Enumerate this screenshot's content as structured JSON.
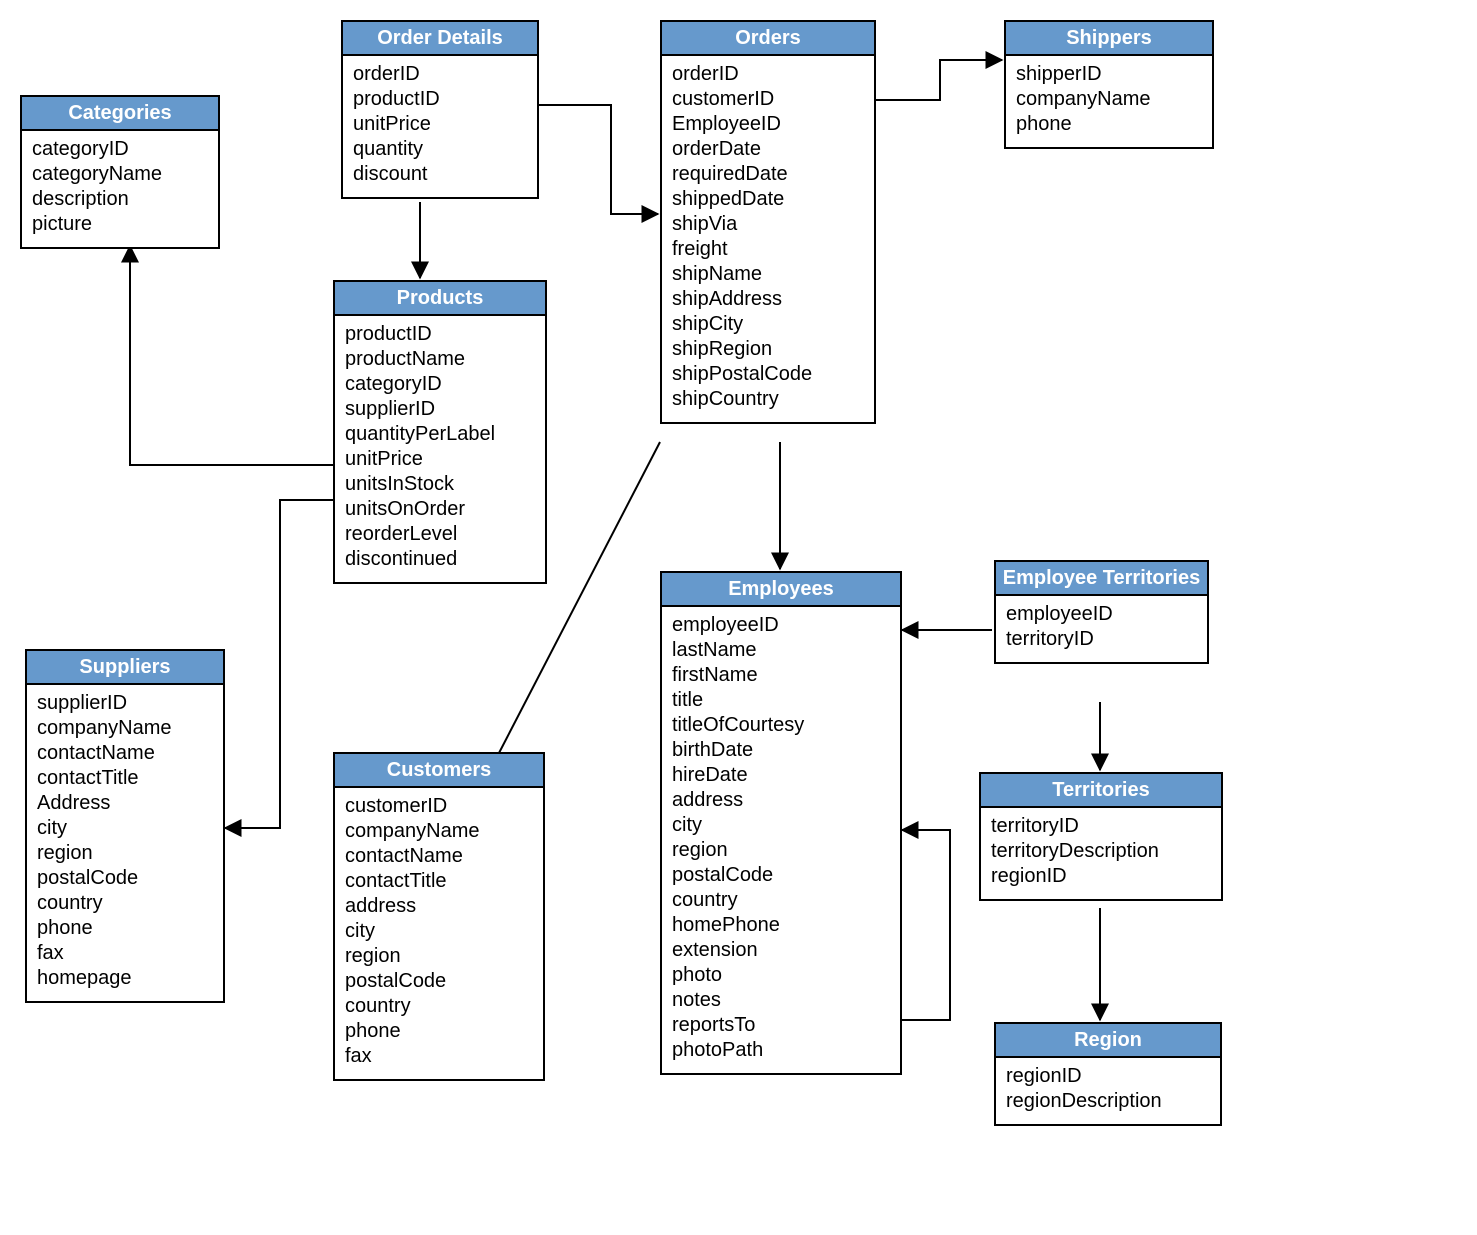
{
  "entities": {
    "categories": {
      "title": "Categories",
      "fields": [
        "categoryID",
        "categoryName",
        "description",
        "picture"
      ]
    },
    "orderDetails": {
      "title": "Order Details",
      "fields": [
        "orderID",
        "productID",
        "unitPrice",
        "quantity",
        "discount"
      ]
    },
    "orders": {
      "title": "Orders",
      "fields": [
        "orderID",
        "customerID",
        "EmployeeID",
        "orderDate",
        "requiredDate",
        "shippedDate",
        "shipVia",
        "freight",
        "shipName",
        "shipAddress",
        "shipCity",
        "shipRegion",
        "shipPostalCode",
        "shipCountry"
      ]
    },
    "shippers": {
      "title": "Shippers",
      "fields": [
        "shipperID",
        "companyName",
        "phone"
      ]
    },
    "products": {
      "title": "Products",
      "fields": [
        "productID",
        "productName",
        "categoryID",
        "supplierID",
        "quantityPerLabel",
        "unitPrice",
        "unitsInStock",
        "unitsOnOrder",
        "reorderLevel",
        "discontinued"
      ]
    },
    "suppliers": {
      "title": "Suppliers",
      "fields": [
        "supplierID",
        "companyName",
        "contactName",
        "contactTitle",
        "Address",
        "city",
        "region",
        "postalCode",
        "country",
        "phone",
        "fax",
        "homepage"
      ]
    },
    "customers": {
      "title": "Customers",
      "fields": [
        "customerID",
        "companyName",
        "contactName",
        "contactTitle",
        "address",
        "city",
        "region",
        "postalCode",
        "country",
        "phone",
        "fax"
      ]
    },
    "employees": {
      "title": "Employees",
      "fields": [
        "employeeID",
        "lastName",
        "firstName",
        "title",
        "titleOfCourtesy",
        "birthDate",
        "hireDate",
        "address",
        "city",
        "region",
        "postalCode",
        "country",
        "homePhone",
        "extension",
        "photo",
        "notes",
        "reportsTo",
        "photoPath"
      ]
    },
    "employeeTerritories": {
      "title": "Employee Territories",
      "fields": [
        "employeeID",
        "territoryID"
      ]
    },
    "territories": {
      "title": "Territories",
      "fields": [
        "territoryID",
        "territoryDescription",
        "regionID"
      ]
    },
    "region": {
      "title": "Region",
      "fields": [
        "regionID",
        "regionDescription"
      ]
    }
  }
}
